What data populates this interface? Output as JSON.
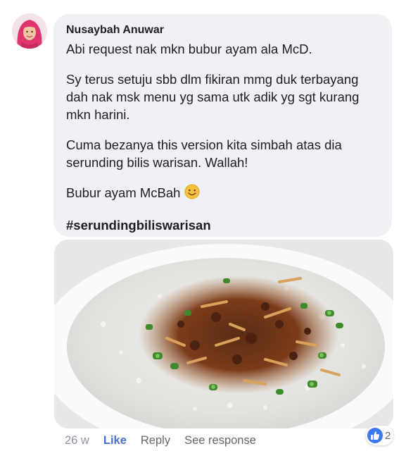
{
  "comment": {
    "author": "Nusaybah Anuwar",
    "paragraphs": [
      "Abi request nak mkn bubur ayam ala McD.",
      "Sy terus setuju sbb dlm fikiran mmg duk terbayang dah nak msk menu yg sama utk adik yg sgt kurang mkn harini.",
      "Cuma bezanya this version kita simbah atas dia serunding bilis warisan. Wallah!",
      "Bubur ayam McBah"
    ],
    "emoji_icon": "smiling-face-icon",
    "hashtag": "#serundingbiliswarisan"
  },
  "photo": {
    "icon": "porridge-photo"
  },
  "actions": {
    "time": "26 w",
    "like": "Like",
    "reply": "Reply",
    "see_response": "See response"
  },
  "reactions": {
    "icon": "thumbs-up-icon",
    "count": "2"
  },
  "colors": {
    "bubble_bg": "#f0f1f4",
    "like_blue": "#4a6fcf",
    "reaction_blue": "#3b79f0",
    "meta_gray": "#8d949e"
  }
}
